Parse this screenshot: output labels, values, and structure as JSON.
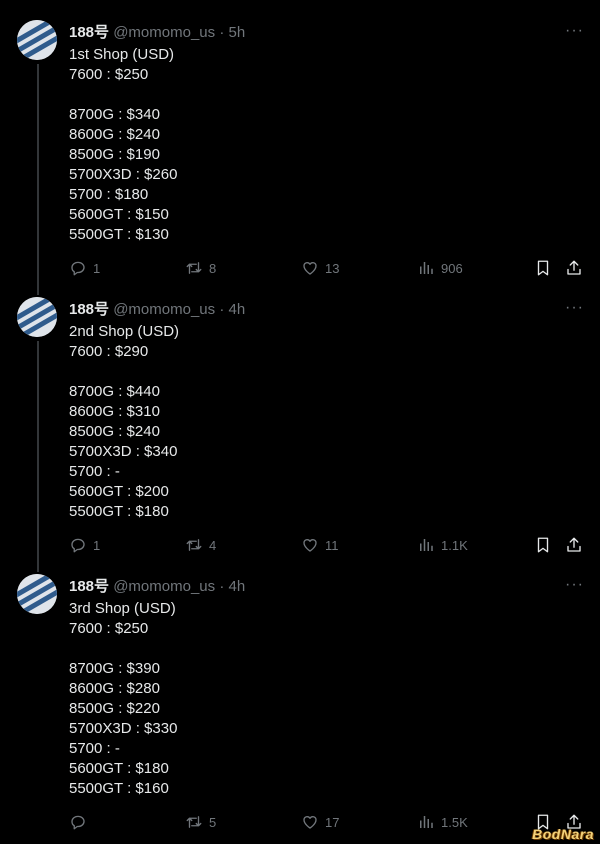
{
  "tweets": [
    {
      "name": "188号",
      "handle": "@momomo_us",
      "dot": "·",
      "time": "5h",
      "more": "···",
      "lines": [
        "1st Shop (USD)",
        "7600 : $250",
        "",
        "8700G : $340",
        "8600G : $240",
        "8500G : $190",
        "5700X3D : $260",
        "5700 : $180",
        "5600GT : $150",
        "5500GT : $130"
      ],
      "replies": "1",
      "reposts": "8",
      "likes": "13",
      "views": "906"
    },
    {
      "name": "188号",
      "handle": "@momomo_us",
      "dot": "·",
      "time": "4h",
      "more": "···",
      "lines": [
        "2nd Shop (USD)",
        "7600 : $290",
        "",
        "8700G : $440",
        "8600G : $310",
        "8500G : $240",
        "5700X3D : $340",
        "5700 : -",
        "5600GT : $200",
        "5500GT : $180"
      ],
      "replies": "1",
      "reposts": "4",
      "likes": "11",
      "views": "1.1K"
    },
    {
      "name": "188号",
      "handle": "@momomo_us",
      "dot": "·",
      "time": "4h",
      "more": "···",
      "lines": [
        "3rd Shop (USD)",
        "7600 : $250",
        "",
        "8700G : $390",
        "8600G : $280",
        "8500G : $220",
        "5700X3D : $330",
        "5700 : -",
        "5600GT : $180",
        "5500GT : $160"
      ],
      "replies": "",
      "reposts": "5",
      "likes": "17",
      "views": "1.5K"
    }
  ],
  "icons": [
    "reply-icon",
    "repost-icon",
    "like-icon",
    "views-icon",
    "bookmark-icon",
    "share-icon"
  ],
  "watermark": "BodNara",
  "colors": {
    "background": "#000000",
    "text": "#e7e9ea",
    "muted": "#71767b",
    "thread_line": "#333639"
  }
}
